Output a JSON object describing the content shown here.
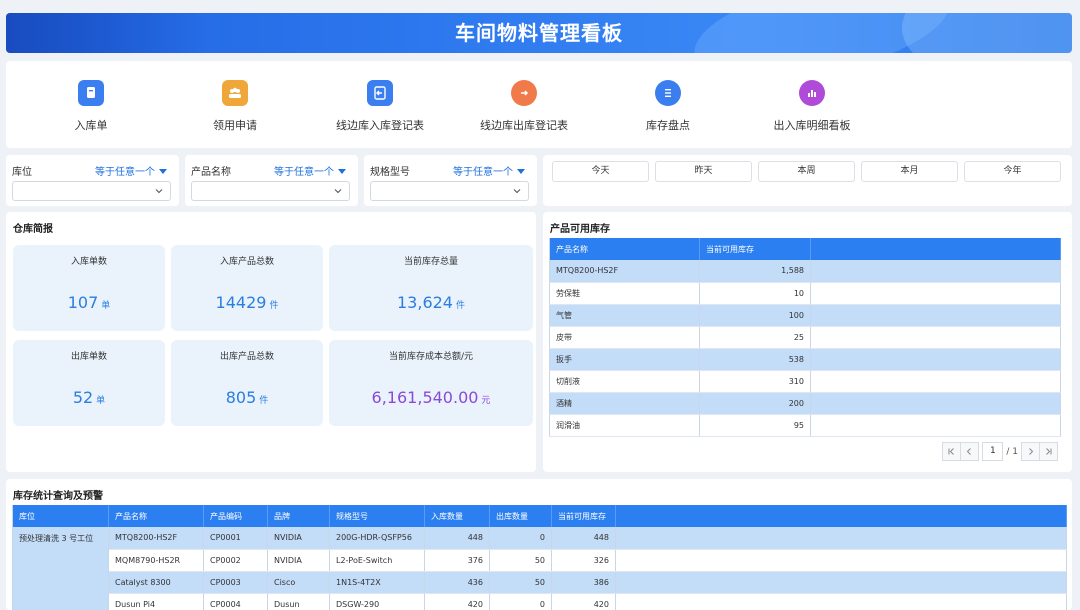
{
  "header": {
    "title": "车间物料管理看板"
  },
  "nav": [
    {
      "label": "入库单",
      "icon": "inbound-form-icon",
      "color": "#3a7ef0"
    },
    {
      "label": "领用申请",
      "icon": "team-request-icon",
      "color": "#f0a73a"
    },
    {
      "label": "线边库入库登记表",
      "icon": "line-inbound-icon",
      "color": "#3a7ef0"
    },
    {
      "label": "线边库出库登记表",
      "icon": "line-outbound-icon",
      "color": "#f07a4a"
    },
    {
      "label": "库存盘点",
      "icon": "inventory-check-icon",
      "color": "#3a7ef0"
    },
    {
      "label": "出入库明细看板",
      "icon": "detail-board-icon",
      "color": "#b04ad8"
    }
  ],
  "filters": [
    {
      "label": "库位",
      "operator": "等于任意一个"
    },
    {
      "label": "产品名称",
      "operator": "等于任意一个"
    },
    {
      "label": "规格型号",
      "operator": "等于任意一个"
    }
  ],
  "date_buttons": [
    "今天",
    "昨天",
    "本周",
    "本月",
    "今年"
  ],
  "summary": {
    "title": "仓库简报",
    "stats": [
      {
        "label": "入库单数",
        "value": "107",
        "unit": "单"
      },
      {
        "label": "入库产品总数",
        "value": "14429",
        "unit": "件"
      },
      {
        "label": "当前库存总量",
        "value": "13,624",
        "unit": "件"
      },
      {
        "label": "出库单数",
        "value": "52",
        "unit": "单"
      },
      {
        "label": "出库产品总数",
        "value": "805",
        "unit": "件"
      },
      {
        "label": "当前库存成本总额/元",
        "value": "6,161,540.00",
        "unit": "元"
      }
    ]
  },
  "stock": {
    "title": "产品可用库存",
    "columns": [
      "产品名称",
      "当前可用库存"
    ],
    "rows": [
      [
        "MTQ8200-HS2F",
        "1,588"
      ],
      [
        "劳保鞋",
        "10"
      ],
      [
        "气管",
        "100"
      ],
      [
        "皮带",
        "25"
      ],
      [
        "扳手",
        "538"
      ],
      [
        "切削液",
        "310"
      ],
      [
        "酒精",
        "200"
      ],
      [
        "润滑油",
        "95"
      ]
    ],
    "pager": {
      "current": "1",
      "total": "/ 1"
    }
  },
  "inventory": {
    "title": "库存统计查询及预警",
    "columns": [
      "库位",
      "产品名称",
      "产品编码",
      "品牌",
      "规格型号",
      "入库数量",
      "出库数量",
      "当前可用库存"
    ],
    "location": "预处理清洗 3 号工位",
    "rows": [
      [
        "MTQ8200-HS2F",
        "CP0001",
        "NVIDIA",
        "200G-HDR-QSFP56",
        "448",
        "0",
        "448"
      ],
      [
        "MQM8790-HS2R",
        "CP0002",
        "NVIDIA",
        "L2-PoE-Switch",
        "376",
        "50",
        "326"
      ],
      [
        "Catalyst 8300",
        "CP0003",
        "Cisco",
        "1N1S-4T2X",
        "436",
        "50",
        "386"
      ],
      [
        "Dusun Pi4",
        "CP0004",
        "Dusun",
        "DSGW-290",
        "420",
        "0",
        "420"
      ]
    ]
  }
}
